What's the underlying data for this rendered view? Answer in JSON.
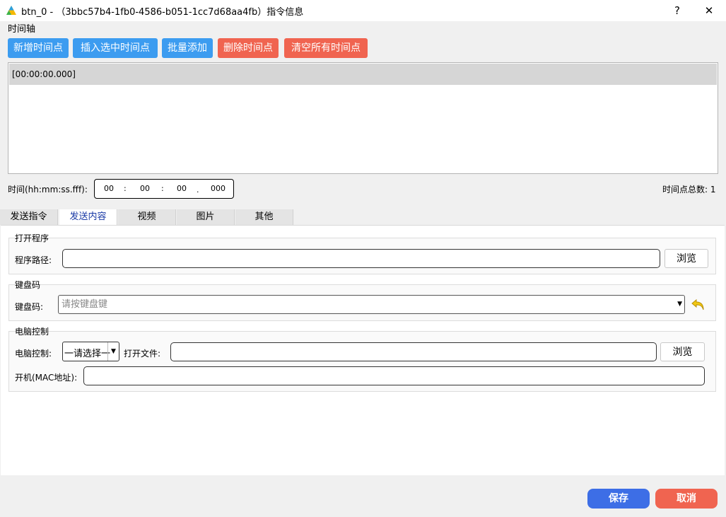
{
  "window": {
    "title": "btn_0 - （3bbc57b4-1fb0-4586-b051-1cc7d68aa4fb）指令信息",
    "help_label": "?",
    "close_label": "✕"
  },
  "timeline": {
    "section_label": "时间轴",
    "buttons": {
      "add": "新增时间点",
      "insert": "插入选中时间点",
      "batch_add": "批量添加",
      "delete": "删除时间点",
      "clear": "清空所有时间点"
    },
    "items": [
      "[00:00:00.000]"
    ],
    "time_label": "时间(hh:mm:ss.fff):",
    "time": {
      "hh": "00",
      "mm": "00",
      "ss": "00",
      "fff": "000",
      "sep1": ":",
      "sep2": ":",
      "sep3": "."
    },
    "total_label": "时间点总数: 1"
  },
  "tabs": [
    "发送指令",
    "发送内容",
    "视频",
    "图片",
    "其他"
  ],
  "active_tab": "发送内容",
  "open_program": {
    "group_title": "打开程序",
    "path_label": "程序路径:",
    "path_value": "",
    "browse_label": "浏览"
  },
  "keyboard": {
    "group_title": "键盘码",
    "label": "键盘码:",
    "placeholder": "请按键盘键"
  },
  "pc_control": {
    "group_title": "电脑控制",
    "label": "电脑控制:",
    "select_value": "一请选择一",
    "open_file_label": "打开文件:",
    "open_file_value": "",
    "browse_label": "浏览",
    "mac_label": "开机(MAC地址):",
    "mac_value": ""
  },
  "footer": {
    "save_label": "保存",
    "cancel_label": "取消"
  },
  "colors": {
    "blue_button": "#3c9cf0",
    "red_button": "#f06450",
    "save_button": "#3d6ee6",
    "cancel_button": "#f06450"
  }
}
